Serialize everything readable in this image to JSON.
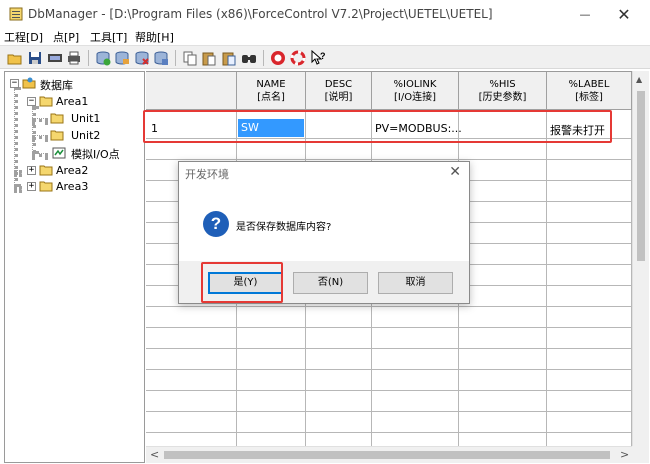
{
  "window": {
    "title": "DbManager - [D:\\Program Files (x86)\\ForceControl V7.2\\Project\\UETEL\\UETEL]",
    "minimize": "—",
    "maximize": "☐",
    "close": "✕"
  },
  "menu": [
    "工程[D]",
    "点[P]",
    "工具[T]",
    "帮助[H]"
  ],
  "toolbar_icons": [
    "open-icon",
    "save-icon",
    "import-icon",
    "print-icon",
    "add-point-icon",
    "edit-point-icon",
    "delete-point-icon",
    "batch-icon",
    "copy-icon",
    "paste-icon",
    "paste-special-icon",
    "find-icon",
    "stop-icon",
    "help-ring-icon",
    "whats-this-icon"
  ],
  "tree": {
    "root": "数据库",
    "area1": "Area1",
    "unit1": "Unit1",
    "unit2": "Unit2",
    "analog_io": "模拟I/O点",
    "area2": "Area2",
    "area3": "Area3",
    "expanded_sign": "−",
    "collapsed_sign": "+"
  },
  "grid": {
    "columns": [
      {
        "top": "NAME",
        "bottom": "[点名]"
      },
      {
        "top": "DESC",
        "bottom": "[说明]"
      },
      {
        "top": "%IOLINK",
        "bottom": "[I/O连接]"
      },
      {
        "top": "%HIS",
        "bottom": "[历史参数]"
      },
      {
        "top": "%LABEL",
        "bottom": "[标签]"
      }
    ],
    "row1": {
      "index": "1",
      "name": "SW",
      "desc": "",
      "iolink": "PV=MODBUS:...",
      "his": "",
      "label": "报警未打开"
    }
  },
  "scroll": {
    "up": "▲",
    "left": "<",
    "right": ">"
  },
  "dialog": {
    "title": "开发环境",
    "close": "✕",
    "icon_glyph": "?",
    "message": "是否保存数据库内容?",
    "buttons": {
      "yes": "是(Y)",
      "no": "否(N)",
      "cancel": "取消"
    }
  },
  "colors": {
    "highlight": "#e53935",
    "selection": "#3399ff",
    "dialog_icon": "#1f5fb8"
  }
}
